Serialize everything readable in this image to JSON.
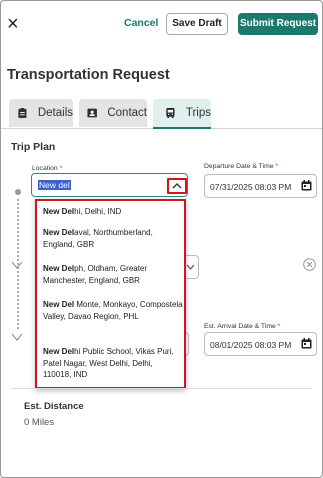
{
  "header": {
    "close_label": "×",
    "cancel_label": "Cancel",
    "save_draft_label": "Save Draft",
    "submit_label": "Submit Request",
    "accent_color": "#1a7a6c"
  },
  "page_title": "Transportation Request",
  "tabs": [
    {
      "label": "Details",
      "icon": "clipboard-icon"
    },
    {
      "label": "Contact",
      "icon": "contact-card-icon"
    },
    {
      "label": "Trips",
      "icon": "bus-icon",
      "active": true
    }
  ],
  "trip_plan": {
    "title": "Trip Plan",
    "location": {
      "label": "Location",
      "required_mark": "*",
      "value": "New del"
    },
    "departure": {
      "label": "Departure Date & Time",
      "required_mark": "*",
      "value": "07/31/2025 08:03 PM"
    },
    "arrival": {
      "label": "Est. Arrival Date & Time",
      "required_mark": "*",
      "value": "08/01/2025 08:03 PM"
    },
    "suggestions": [
      {
        "match": "New Del",
        "rest": "hi, Delhi, IND"
      },
      {
        "match": "New Del",
        "rest": "aval, Northumberland, England, GBR"
      },
      {
        "match": "New Del",
        "rest": "ph, Oldham, Greater Manchester, England, GBR"
      },
      {
        "match": "New Del",
        "rest": " Monte, Monkayo, Compostela Valley, Davao Region, PHL"
      },
      {
        "match": "New Del",
        "rest": "hi Public School, Vikas Puri, Patel Nagar, West Delhi, Delhi, 110018, IND"
      }
    ]
  },
  "distance": {
    "title": "Est. Distance",
    "value": "0 Miles"
  }
}
